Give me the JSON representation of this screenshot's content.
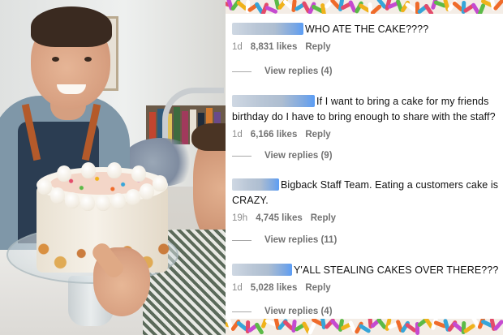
{
  "comments": [
    {
      "text": "WHO ATE THE CAKE????",
      "time": "1d",
      "likes": "8,831 likes",
      "reply": "Reply",
      "view_replies": "View replies (4)"
    },
    {
      "text": "If I want to bring a cake for my friends birthday do I have to bring enough to share with the staff?",
      "time": "1d",
      "likes": "6,166 likes",
      "reply": "Reply",
      "view_replies": "View replies (9)"
    },
    {
      "text": "Bigback Staff Team. Eating a customers cake is CRAZY.",
      "time": "19h",
      "likes": "4,745 likes",
      "reply": "Reply",
      "view_replies": "View replies (11)"
    },
    {
      "text": "Y'ALL STEALING CAKES OVER THERE???",
      "time": "1d",
      "likes": "5,028 likes",
      "reply": "Reply",
      "view_replies": "View replies (4)"
    }
  ],
  "colors": {
    "text": "#111111",
    "meta": "#737373",
    "username_blur": "#5b9df5",
    "sprinkles": [
      "#e34b6a",
      "#f0b21b",
      "#36a5d9",
      "#5cba47",
      "#ef6b2a",
      "#c54ad0",
      "#ffffff"
    ]
  },
  "icons": {
    "username": "blurred-username",
    "photo": "cake-photo"
  }
}
